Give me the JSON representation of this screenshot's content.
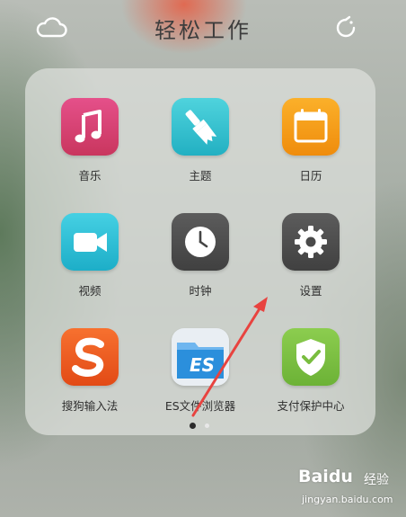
{
  "header": {
    "title": "轻松工作",
    "left_icon": "cloud-icon",
    "right_icon": "refresh-icon"
  },
  "apps": [
    {
      "label": "音乐",
      "icon": "music-note-icon",
      "color": "#d64473"
    },
    {
      "label": "主题",
      "icon": "paintbrush-icon",
      "color": "#33c2cf"
    },
    {
      "label": "日历",
      "icon": "calendar-icon",
      "color": "#f59d17"
    },
    {
      "label": "视频",
      "icon": "video-camera-icon",
      "color": "#27c2d8"
    },
    {
      "label": "时钟",
      "icon": "clock-icon",
      "color": "#4e4e4e"
    },
    {
      "label": "设置",
      "icon": "gear-icon",
      "color": "#4e4e4e"
    },
    {
      "label": "搜狗输入法",
      "icon": "sogou-s-icon",
      "color": "#f05a22"
    },
    {
      "label": "ES文件浏览器",
      "icon": "es-folder-icon",
      "color": "#2b8fdc"
    },
    {
      "label": "支付保护中心",
      "icon": "shield-check-icon",
      "color": "#7cc243"
    }
  ],
  "pager": {
    "pages": 2,
    "current": 1
  },
  "watermark": {
    "logo": "Baidu",
    "product": "经验",
    "url": "jingyan.baidu.com"
  },
  "annotation": {
    "type": "arrow",
    "color": "#e8433f"
  }
}
